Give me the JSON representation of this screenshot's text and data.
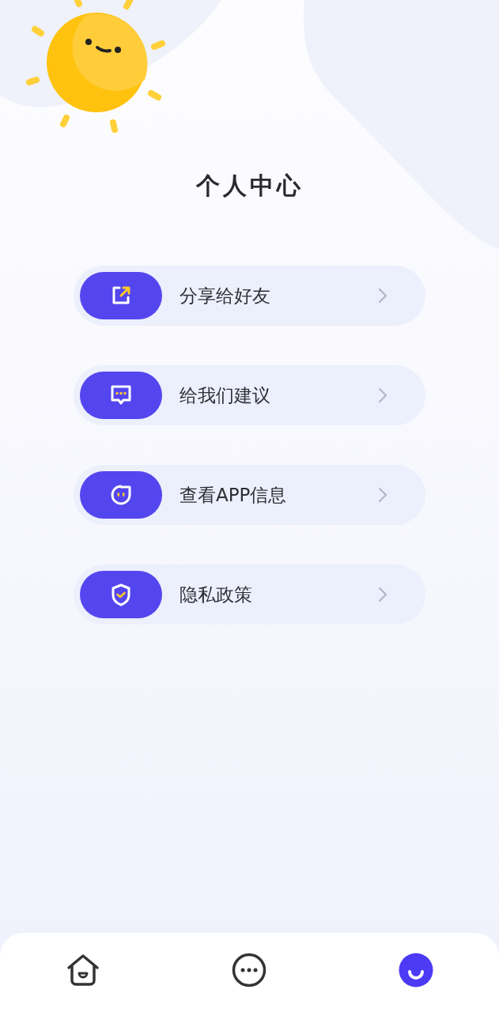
{
  "title": "个人中心",
  "menu": [
    {
      "kind": "share",
      "label": "分享给好友"
    },
    {
      "kind": "feedback",
      "label": "给我们建议"
    },
    {
      "kind": "info",
      "label": "查看APP信息"
    },
    {
      "kind": "privacy",
      "label": "隐私政策"
    }
  ],
  "tab_bar": [
    {
      "kind": "home",
      "selected": false
    },
    {
      "kind": "more",
      "selected": false
    },
    {
      "kind": "profile",
      "selected": true
    }
  ]
}
